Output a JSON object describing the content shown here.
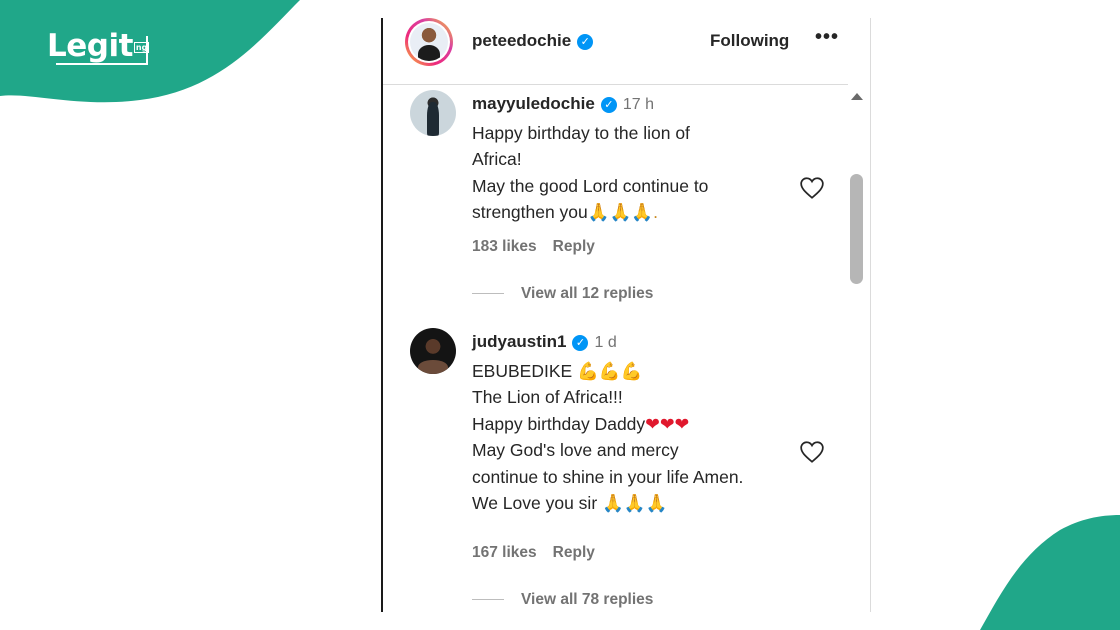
{
  "brand": {
    "logo_text": "Legit",
    "logo_badge": "ng",
    "color": "#20a789"
  },
  "post": {
    "username": "peteedochie",
    "follow_label": "Following",
    "more_label": "•••"
  },
  "comments": [
    {
      "username": "mayyuledochie",
      "time": "17 h",
      "lines": [
        "Happy birthday to the lion of",
        "Africa!",
        "May the good Lord continue to",
        "strengthen you"
      ],
      "line4_emoji": "🙏🙏🙏.",
      "likes": "183 likes",
      "reply_label": "Reply",
      "view_replies": "View all 12 replies"
    },
    {
      "username": "judyaustin1",
      "time": "1 d",
      "lines": [
        "EBUBEDIKE",
        "The Lion of Africa!!!",
        "Happy birthday Daddy",
        "May God's love and mercy",
        "continue to shine in your life Amen.",
        "We Love you sir "
      ],
      "line1_emoji": " 💪💪💪",
      "line3_emoji": "❤❤❤",
      "line6_emoji": "🙏🙏🙏",
      "likes": "167 likes",
      "reply_label": "Reply",
      "view_replies": "View all 78 replies"
    }
  ],
  "icons": {
    "verified": "✓",
    "heart": "heart-outline-icon"
  }
}
